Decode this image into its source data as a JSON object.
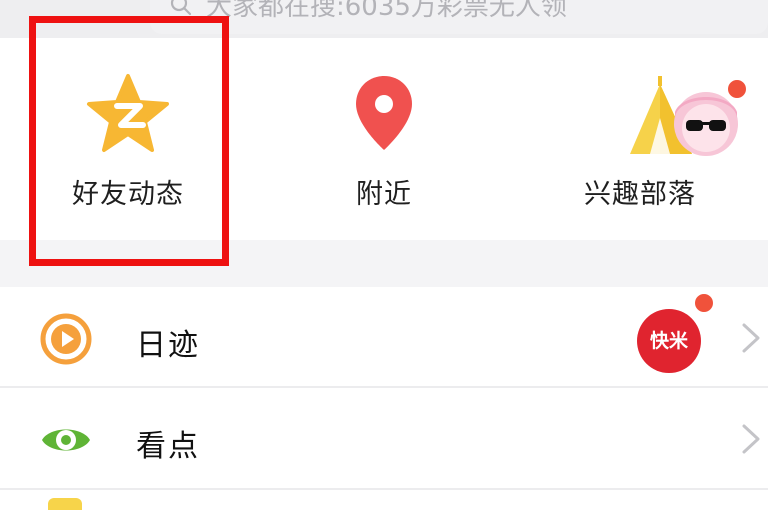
{
  "search": {
    "placeholder": "大家都在搜:6035万彩票无人领"
  },
  "quick_entries": [
    {
      "label": "好友动态",
      "icon": "qzone-star-icon",
      "highlighted": true
    },
    {
      "label": "附近",
      "icon": "location-pin-icon"
    },
    {
      "label": "兴趣部落",
      "icon": "tribe-tent-avatar-icon",
      "badge": "red-dot"
    }
  ],
  "list": [
    {
      "label": "日迹",
      "icon": "play-circle-icon",
      "badge_text": "快米"
    },
    {
      "label": "看点",
      "icon": "eye-icon"
    }
  ],
  "colors": {
    "highlight": "#ee1111",
    "star": "#f7b733",
    "pin": "#f0514f",
    "play": "#f5a03c",
    "eye": "#5fb436",
    "badge": "#e0242f",
    "dot": "#f0523b"
  }
}
